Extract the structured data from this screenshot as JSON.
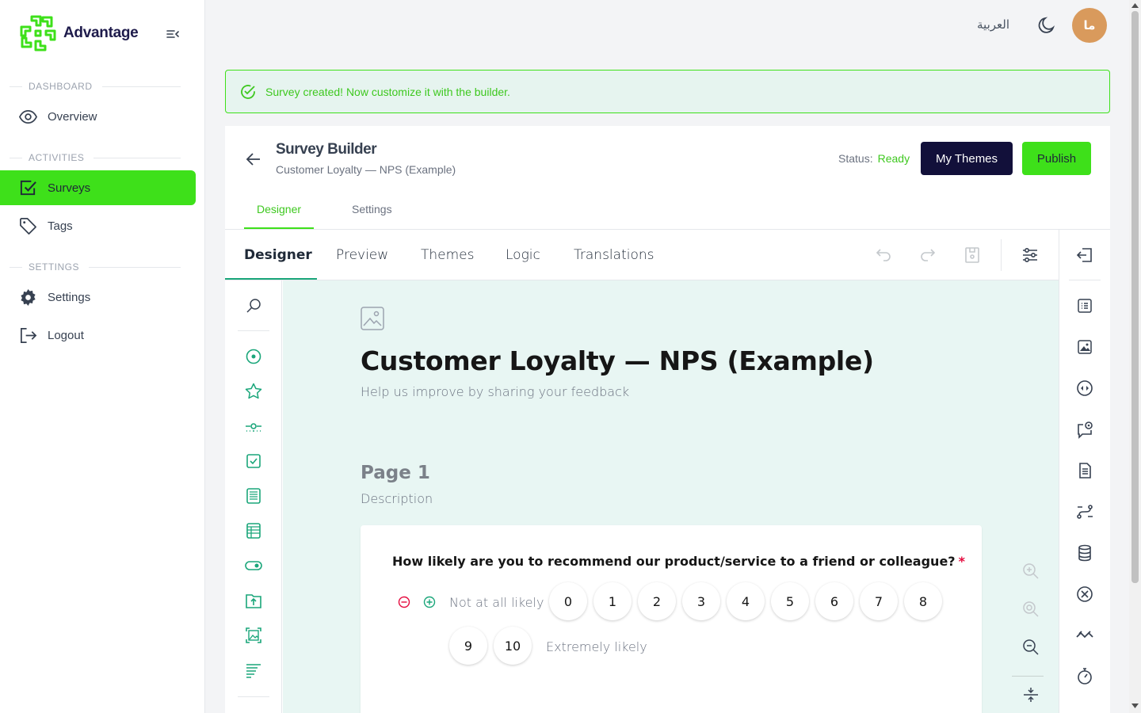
{
  "brand": {
    "name": "Advantage",
    "color": "#3ee01a"
  },
  "sidebar": {
    "sections": [
      {
        "label": "DASHBOARD"
      },
      {
        "label": "ACTIVITIES"
      },
      {
        "label": "SETTINGS"
      }
    ],
    "items": [
      {
        "label": "Overview",
        "icon": "eye-icon"
      },
      {
        "label": "Surveys",
        "icon": "checkbox-icon",
        "active": true
      },
      {
        "label": "Tags",
        "icon": "tag-icon"
      },
      {
        "label": "Settings",
        "icon": "gear-icon"
      },
      {
        "label": "Logout",
        "icon": "logout-icon"
      }
    ]
  },
  "topbar": {
    "language": "العربية",
    "avatar_initials": "ما"
  },
  "alert": {
    "text": "Survey created! Now customize it with the builder."
  },
  "builder": {
    "title": "Survey Builder",
    "subtitle": "Customer Loyalty — NPS (Example)",
    "status_label": "Status:",
    "status_value": "Ready",
    "themes_button": "My Themes",
    "publish_button": "Publish",
    "outer_tabs": [
      {
        "label": "Designer",
        "active": true
      },
      {
        "label": "Settings"
      }
    ]
  },
  "creator": {
    "tabs": [
      {
        "label": "Designer",
        "active": true
      },
      {
        "label": "Preview"
      },
      {
        "label": "Themes"
      },
      {
        "label": "Logic"
      },
      {
        "label": "Translations"
      }
    ],
    "toolbar_icons": [
      "undo-icon",
      "redo-icon",
      "save-icon",
      "settings-sliders-icon"
    ],
    "right_rail_icons": [
      "collapse-panel-icon",
      "general-icon",
      "logo-icon",
      "navigation-icon",
      "question-settings-icon",
      "pages-icon",
      "conditions-icon",
      "data-icon",
      "validation-icon",
      "show-on-completed-icon",
      "timer-icon"
    ],
    "toolbox_icons": [
      "radiogroup-icon",
      "rating-icon",
      "slider-icon",
      "checkbox-icon",
      "multiple-text-icon",
      "matrix-icon",
      "boolean-icon",
      "file-upload-icon",
      "image-picker-icon",
      "ranking-icon"
    ]
  },
  "survey": {
    "title": "Customer Loyalty — NPS (Example)",
    "description": "Help us improve by sharing your feedback",
    "page_title": "Page 1",
    "page_description": "Description",
    "question": {
      "title": "How likely are you to recommend our product/service to a friend or colleague?",
      "required_mark": "*",
      "min_label": "Not at all likely",
      "max_label": "Extremely likely",
      "rates": [
        "0",
        "1",
        "2",
        "3",
        "4",
        "5",
        "6",
        "7",
        "8",
        "9",
        "10"
      ]
    }
  },
  "colors": {
    "accent_green": "#3ee01a",
    "dark_navy": "#12103a",
    "teal": "#1aa67a",
    "canvas_bg": "#e8f6f3",
    "required_red": "#e50a3e"
  }
}
